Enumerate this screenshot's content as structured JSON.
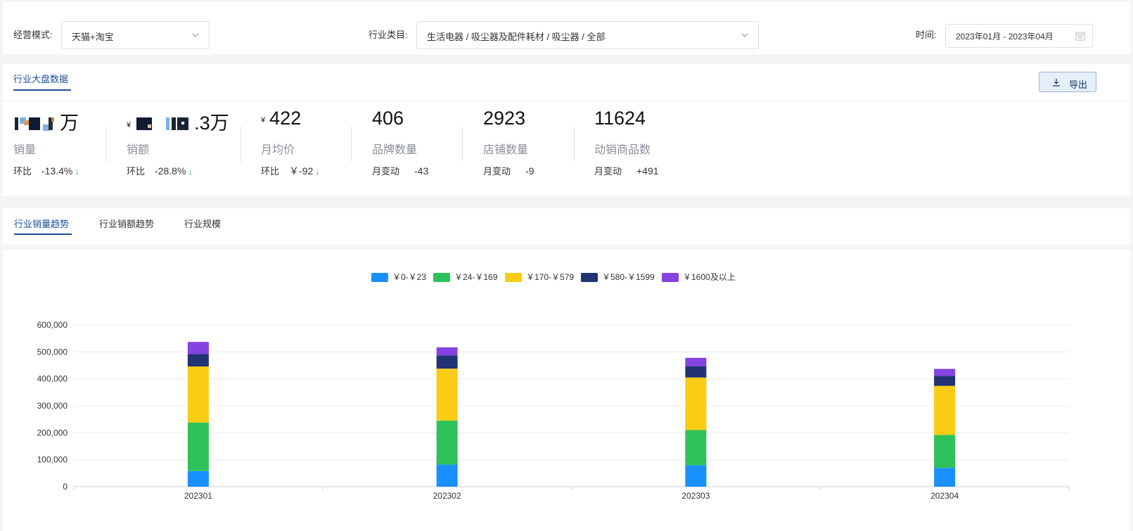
{
  "filters": {
    "mode_label": "经营模式:",
    "mode_value": "天猫+淘宝",
    "category_label": "行业类目:",
    "category_value": "生活电器 / 吸尘器及配件耗材 / 吸尘器 / 全部",
    "time_label": "时间:",
    "time_value": "2023年01月 - 2023年04月"
  },
  "overview": {
    "tab_title": "行业大盘数据",
    "export_label": "导出",
    "metrics": [
      {
        "value_suffix": "万",
        "name": "销量",
        "change_label": "环比",
        "change_value": "-13.4%",
        "trend": "down"
      },
      {
        "yen": "¥",
        "value_suffix": ".3万",
        "name": "销额",
        "change_label": "环比",
        "change_value": "-28.8%",
        "trend": "down"
      },
      {
        "yen": "¥",
        "value": "422",
        "name": "月均价",
        "change_label": "环比",
        "change_value": "￥-92",
        "trend": "down"
      },
      {
        "value": "406",
        "name": "品牌数量",
        "change_label": "月变动",
        "change_value": "-43"
      },
      {
        "value": "2923",
        "name": "店铺数量",
        "change_label": "月变动",
        "change_value": "-9"
      },
      {
        "value": "11624",
        "name": "动销商品数",
        "change_label": "月变动",
        "change_value": "+491"
      }
    ]
  },
  "trend_tabs": {
    "items": [
      "行业销量趋势",
      "行业销额趋势",
      "行业规模"
    ],
    "active": 0
  },
  "chart_data": {
    "type": "bar",
    "stacked": true,
    "categories": [
      "202301",
      "202302",
      "202303",
      "202304"
    ],
    "series": [
      {
        "name": "￥0-￥23",
        "color": "#1890ff",
        "values": [
          58000,
          82000,
          80000,
          70000
        ]
      },
      {
        "name": "￥24-￥169",
        "color": "#2fc25b",
        "values": [
          180000,
          163000,
          130000,
          122000
        ]
      },
      {
        "name": "￥170-￥579",
        "color": "#facc14",
        "values": [
          208000,
          193000,
          195000,
          182000
        ]
      },
      {
        "name": "￥580-￥1599",
        "color": "#223273",
        "values": [
          46000,
          49000,
          42000,
          37000
        ]
      },
      {
        "name": "￥1600及以上",
        "color": "#8543e0",
        "values": [
          45000,
          30000,
          31000,
          26000
        ]
      }
    ],
    "ylim": [
      0,
      600000
    ],
    "yticks": [
      "0",
      "100,000",
      "200,000",
      "300,000",
      "400,000",
      "500,000",
      "600,000"
    ],
    "ytick_values": [
      0,
      100000,
      200000,
      300000,
      400000,
      500000,
      600000
    ],
    "legend_position": "top",
    "grid": true
  }
}
